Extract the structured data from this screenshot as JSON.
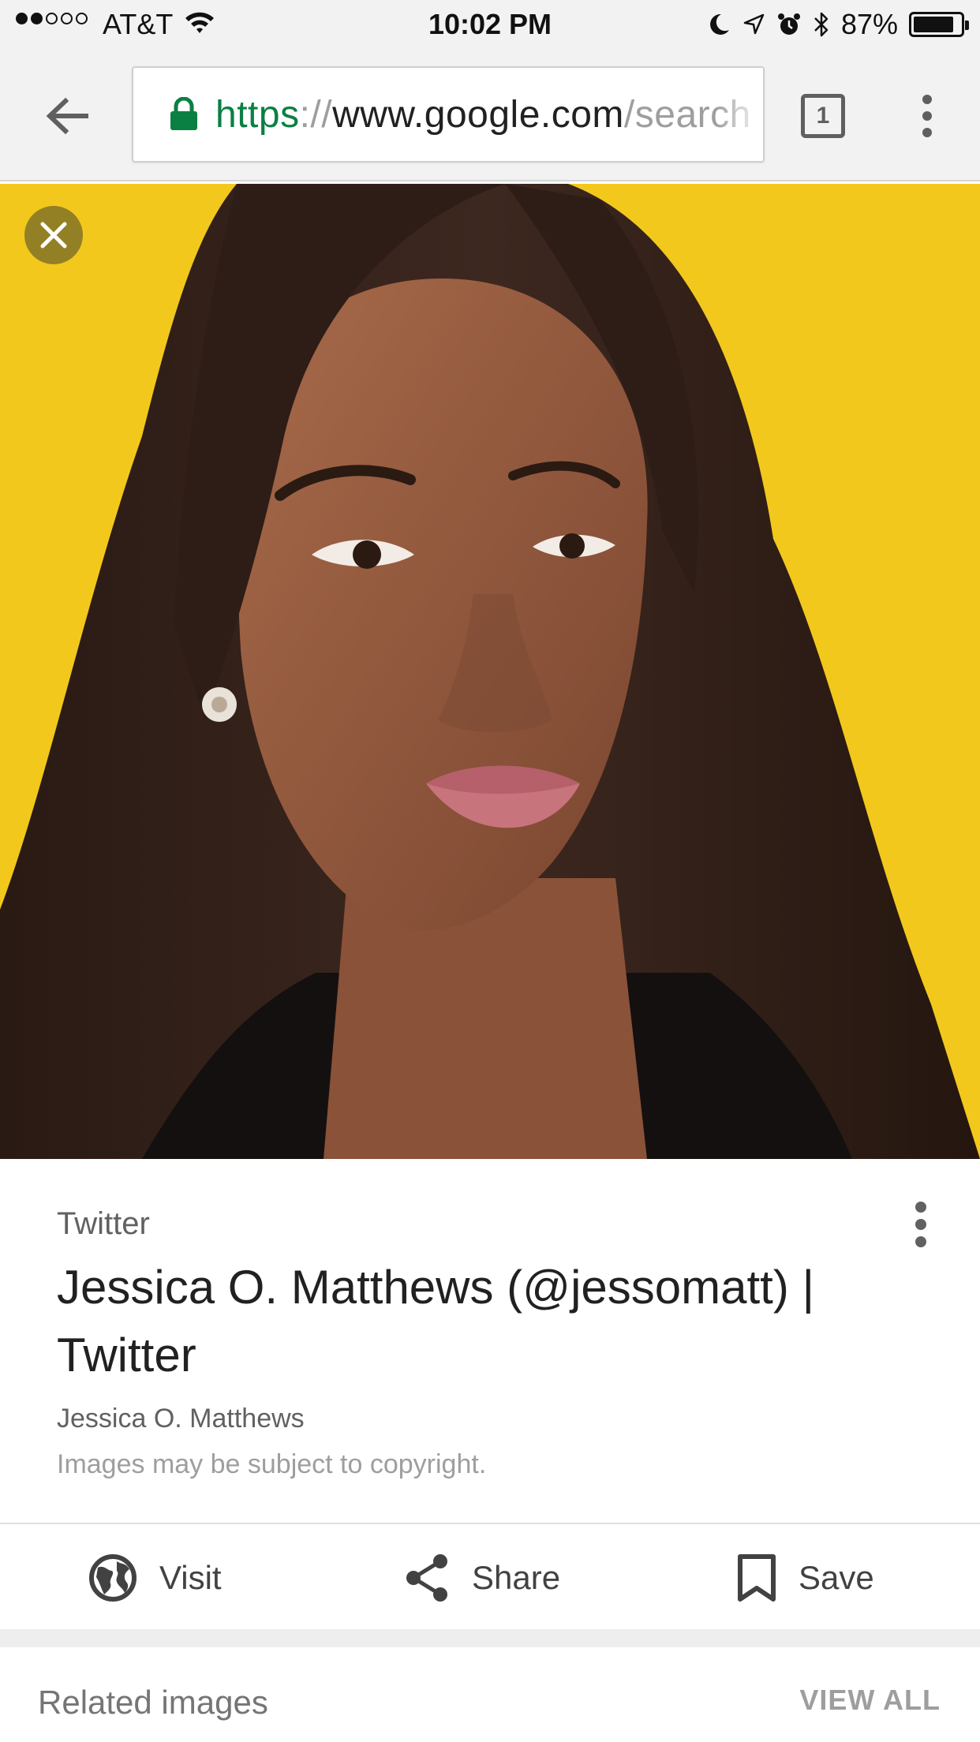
{
  "status_bar": {
    "carrier": "AT&T",
    "time": "10:02 PM",
    "battery": "87%",
    "battery_level": 0.87,
    "signal_bars": 2,
    "icons": [
      "signal-dots-icon",
      "wifi-icon",
      "moon-icon",
      "location-arrow-icon",
      "alarm-clock-icon",
      "bluetooth-icon",
      "battery-icon"
    ]
  },
  "toolbar": {
    "back_icon": "arrow-back-icon",
    "url_scheme": "https",
    "url_sep": "://",
    "url_host": "www.google.com",
    "url_path": "/search",
    "tab_count": "1",
    "menu_icon": "more-vert-icon",
    "colors": {
      "secure": "#0b8043",
      "muted": "#9e9e9e"
    }
  },
  "image_viewer": {
    "close_icon": "close-icon",
    "photo_background": "#f2c81d"
  },
  "result": {
    "source": "Twitter",
    "title": "Jessica O. Matthews (@jessomatt) | Twitter",
    "subtitle": "Jessica O. Matthews",
    "copyright": "Images may be subject to copyright.",
    "menu_icon": "more-vert-icon"
  },
  "actions": [
    {
      "label": "Visit",
      "icon": "globe-icon"
    },
    {
      "label": "Share",
      "icon": "share-icon"
    },
    {
      "label": "Save",
      "icon": "bookmark-icon"
    }
  ],
  "related": {
    "title": "Related images",
    "view_all": "VIEW ALL"
  }
}
